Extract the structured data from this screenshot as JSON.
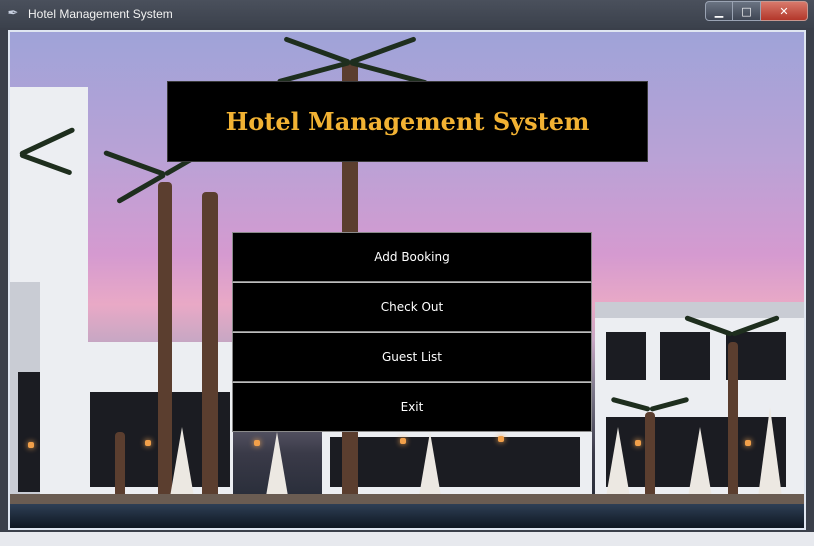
{
  "window": {
    "title": "Hotel Management System",
    "controls": {
      "minimize_icon": "minimize-icon",
      "maximize_icon": "maximize-icon",
      "close_icon": "close-icon"
    }
  },
  "header": {
    "title": "Hotel Management System",
    "title_color": "#f2b233"
  },
  "menu": {
    "items": [
      {
        "label": "Add Booking"
      },
      {
        "label": "Check Out"
      },
      {
        "label": "Guest List"
      },
      {
        "label": "Exit"
      }
    ]
  },
  "background": {
    "scene": "hotel-poolside-at-dusk"
  }
}
